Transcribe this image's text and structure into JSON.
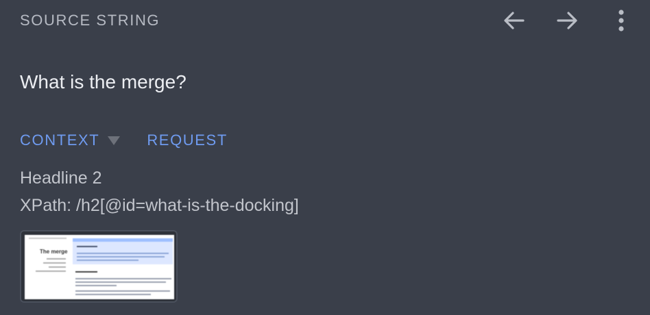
{
  "header": {
    "title": "SOURCE STRING",
    "back_icon": "arrow-left-icon",
    "forward_icon": "arrow-right-icon",
    "menu_icon": "more-vertical-icon"
  },
  "source": {
    "text": "What is the merge?"
  },
  "tabs": [
    {
      "label": "CONTEXT"
    },
    {
      "label": "REQUEST"
    }
  ],
  "context": {
    "element_type": "Headline 2",
    "xpath": "XPath: /h2[@id=what-is-the-docking]"
  },
  "thumbnail": {
    "page_heading": "The merge"
  },
  "colors": {
    "background": "#3a3f4a",
    "accent": "#6f9bf0",
    "muted_text": "#b6bac3"
  }
}
